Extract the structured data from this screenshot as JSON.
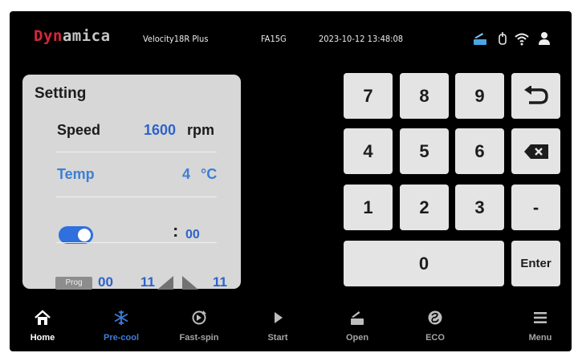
{
  "status_bar": {
    "logo": {
      "part1": "Dyn",
      "part2": "amica"
    },
    "model": "Velocity18R Plus",
    "serial": "FA15G",
    "datetime": "2023-10-12  13:48:08",
    "icons": [
      "lid-open-icon",
      "usb-icon",
      "wifi-icon",
      "user-icon"
    ]
  },
  "settings": {
    "title": "Setting",
    "speed": {
      "label": "Speed",
      "value": "1600",
      "unit": "rpm"
    },
    "temp": {
      "label": "Temp",
      "value": "4",
      "unit": "°C"
    },
    "timer": {
      "enabled": true,
      "colon": ":",
      "minutes": "00"
    },
    "program": {
      "badge": "Prog",
      "number": "00",
      "accel": "11",
      "decel": "11"
    }
  },
  "keypad": {
    "k7": "7",
    "k8": "8",
    "k9": "9",
    "k4": "4",
    "k5": "5",
    "k6": "6",
    "k1": "1",
    "k2": "2",
    "k3": "3",
    "k0": "0",
    "minus": "-",
    "enter": "Enter",
    "back_icon": "back-arrow-icon",
    "delete_icon": "backspace-icon"
  },
  "nav": [
    {
      "label": "Home",
      "icon": "home-icon"
    },
    {
      "label": "Pre-cool",
      "icon": "snowflake-icon"
    },
    {
      "label": "Fast-spin",
      "icon": "fast-spin-icon"
    },
    {
      "label": "Start",
      "icon": "play-icon"
    },
    {
      "label": "Open",
      "icon": "lid-open-icon"
    },
    {
      "label": "ECO",
      "icon": "eco-icon"
    },
    {
      "label": "Menu",
      "icon": "menu-icon"
    }
  ],
  "colors": {
    "screen_bg": "#000000",
    "panel_bg": "#d7d7d7",
    "key_bg": "#e4e4e4",
    "accent_blue": "#2e63c9",
    "logo_red": "#d8263a",
    "toggle_on": "#2f6fde",
    "nav_active": "#ffffff",
    "nav_highlight": "#3f7dd9",
    "nav_inactive": "#a4a4a4"
  }
}
